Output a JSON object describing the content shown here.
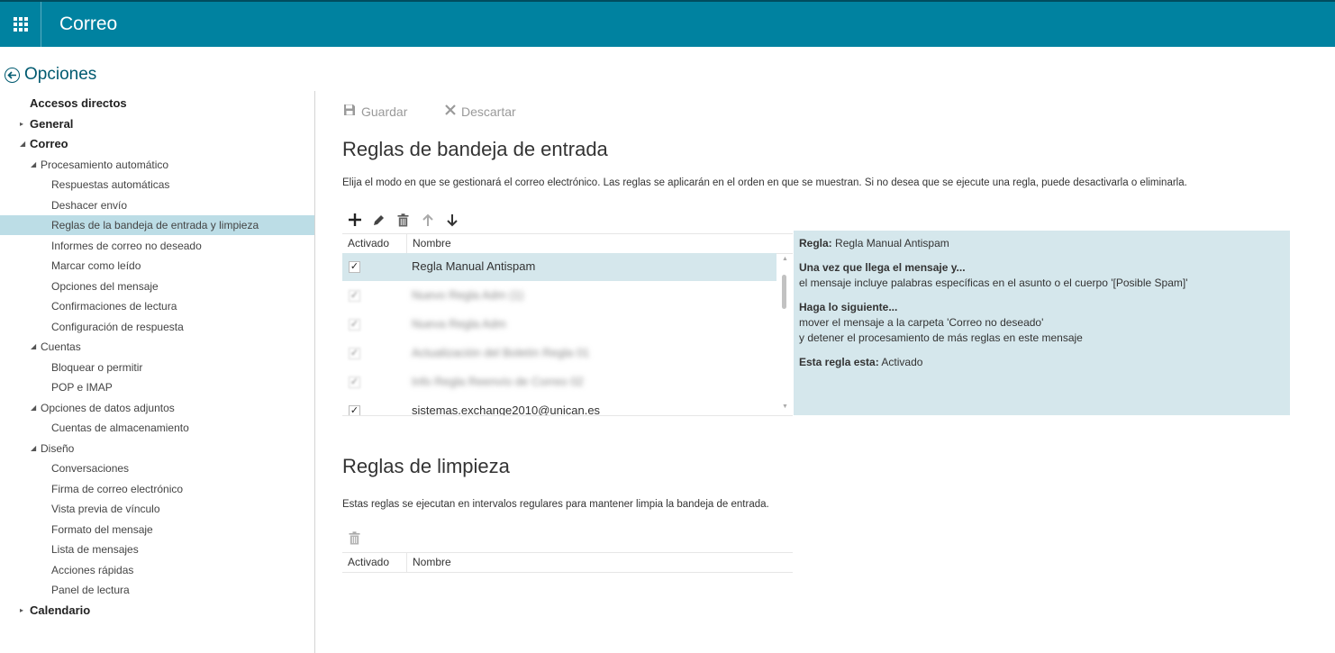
{
  "app": {
    "title": "Correo"
  },
  "options": {
    "title": "Opciones"
  },
  "nav": [
    {
      "label": "Accesos directos",
      "level": 0,
      "arrow": ""
    },
    {
      "label": "General",
      "level": 0,
      "arrow": "▸"
    },
    {
      "label": "Correo",
      "level": 0,
      "arrow": "◢"
    },
    {
      "label": "Procesamiento automático",
      "level": 1,
      "arrow": "◢"
    },
    {
      "label": "Respuestas automáticas",
      "level": 2,
      "arrow": ""
    },
    {
      "label": "Deshacer envío",
      "level": 2,
      "arrow": ""
    },
    {
      "label": "Reglas de la bandeja de entrada y limpieza",
      "level": 2,
      "arrow": "",
      "selected": true
    },
    {
      "label": "Informes de correo no deseado",
      "level": 2,
      "arrow": ""
    },
    {
      "label": "Marcar como leído",
      "level": 2,
      "arrow": ""
    },
    {
      "label": "Opciones del mensaje",
      "level": 2,
      "arrow": ""
    },
    {
      "label": "Confirmaciones de lectura",
      "level": 2,
      "arrow": ""
    },
    {
      "label": "Configuración de respuesta",
      "level": 2,
      "arrow": ""
    },
    {
      "label": "Cuentas",
      "level": 1,
      "arrow": "◢"
    },
    {
      "label": "Bloquear o permitir",
      "level": 2,
      "arrow": ""
    },
    {
      "label": "POP e IMAP",
      "level": 2,
      "arrow": ""
    },
    {
      "label": "Opciones de datos adjuntos",
      "level": 1,
      "arrow": "◢"
    },
    {
      "label": "Cuentas de almacenamiento",
      "level": 2,
      "arrow": ""
    },
    {
      "label": "Diseño",
      "level": 1,
      "arrow": "◢"
    },
    {
      "label": "Conversaciones",
      "level": 2,
      "arrow": ""
    },
    {
      "label": "Firma de correo electrónico",
      "level": 2,
      "arrow": ""
    },
    {
      "label": "Vista previa de vínculo",
      "level": 2,
      "arrow": ""
    },
    {
      "label": "Formato del mensaje",
      "level": 2,
      "arrow": ""
    },
    {
      "label": "Lista de mensajes",
      "level": 2,
      "arrow": ""
    },
    {
      "label": "Acciones rápidas",
      "level": 2,
      "arrow": ""
    },
    {
      "label": "Panel de lectura",
      "level": 2,
      "arrow": ""
    },
    {
      "label": "Calendario",
      "level": 0,
      "arrow": "▸"
    }
  ],
  "toolbar": {
    "save": "Guardar",
    "discard": "Descartar"
  },
  "inbox": {
    "title": "Reglas de bandeja de entrada",
    "description": "Elija el modo en que se gestionará el correo electrónico. Las reglas se aplicarán en el orden en que se muestran. Si no desea que se ejecute una regla, puede desactivarla o eliminarla.",
    "col_enabled": "Activado",
    "col_name": "Nombre",
    "rules": [
      {
        "name": "Regla Manual Antispam",
        "checked": true,
        "selected": true,
        "blurred": false
      },
      {
        "name": "Nuevo Regla Adm (1)",
        "checked": true,
        "blurred": true
      },
      {
        "name": "Nueva Regla Adm",
        "checked": true,
        "blurred": true
      },
      {
        "name": "Actualización del Boletín Regla 01",
        "checked": true,
        "blurred": true
      },
      {
        "name": "Info Regla Reenvío de Correo 02",
        "checked": true,
        "blurred": true
      },
      {
        "name": "sistemas.exchange2010@unican.es",
        "checked": true,
        "blurred": false
      }
    ]
  },
  "detail": {
    "rule_label": "Regla:",
    "rule_name": "Regla Manual Antispam",
    "when_heading": "Una vez que llega el mensaje y...",
    "when_text": "el mensaje incluye palabras específicas en el asunto o el cuerpo '[Posible Spam]'",
    "do_heading": "Haga lo siguiente...",
    "do_text_1": "mover el mensaje a la carpeta 'Correo no deseado'",
    "do_text_2": "y detener el procesamiento de más reglas en este mensaje",
    "status_label": "Esta regla esta:",
    "status_value": "Activado"
  },
  "cleanup": {
    "title": "Reglas de limpieza",
    "description": "Estas reglas se ejecutan en intervalos regulares para mantener limpia la bandeja de entrada.",
    "col_enabled": "Activado",
    "col_name": "Nombre"
  },
  "colors": {
    "header": "#0082a0",
    "selected_nav": "#bcdde6",
    "detail_bg": "#d5e7ec"
  }
}
